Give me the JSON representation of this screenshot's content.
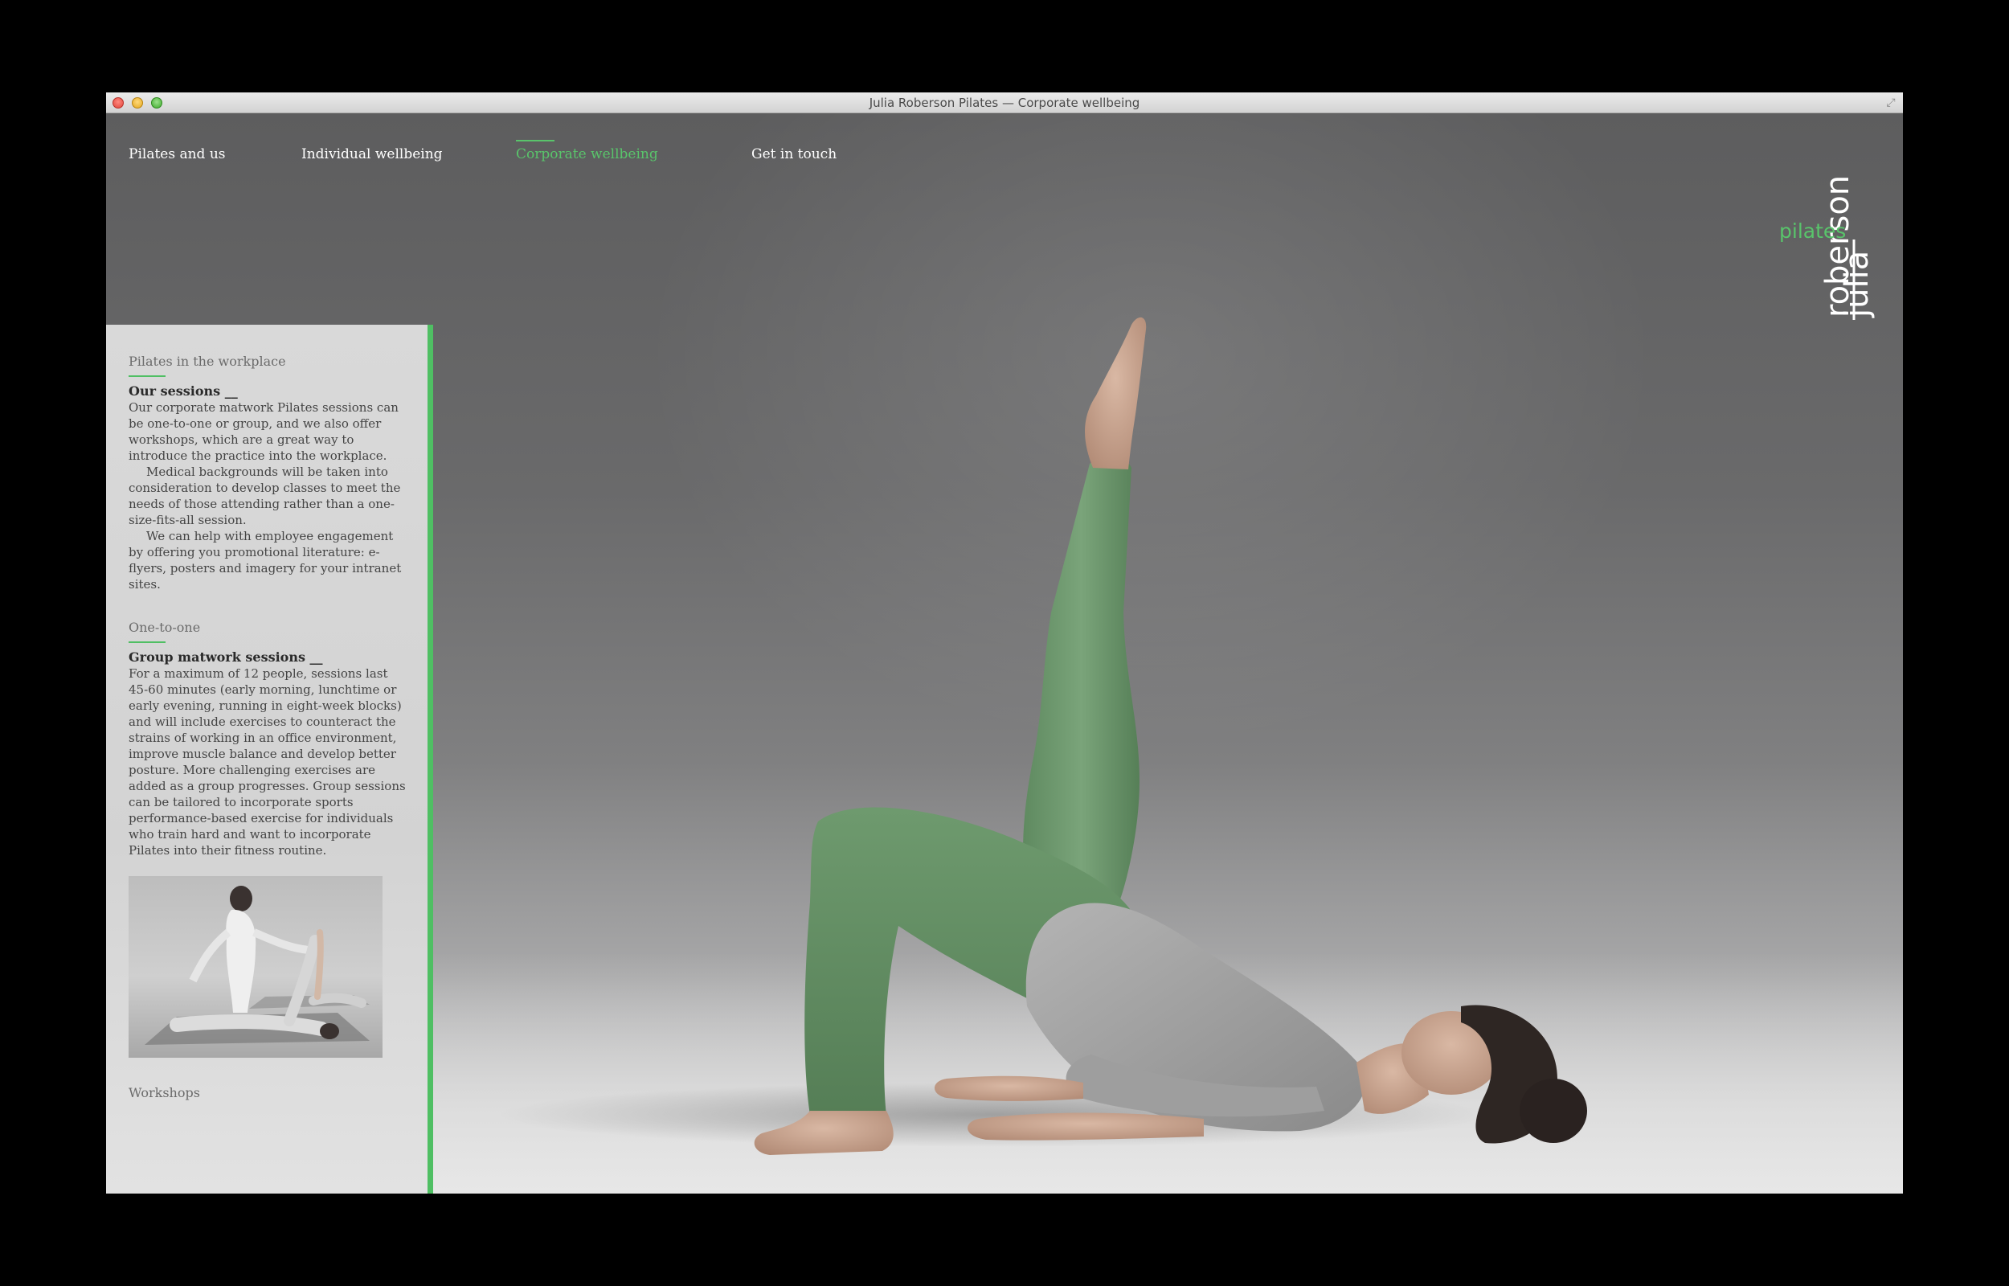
{
  "window": {
    "title": "Julia Roberson Pilates — Corporate wellbeing"
  },
  "nav": {
    "items": [
      {
        "label": "Pilates and us",
        "active": false
      },
      {
        "label": "Individual wellbeing",
        "active": false
      },
      {
        "label": "Corporate wellbeing",
        "active": true
      },
      {
        "label": "Get in touch",
        "active": false
      }
    ]
  },
  "logo": {
    "first": "julia",
    "last": "roberson",
    "tag": "pilates"
  },
  "sidebar": {
    "sections": [
      {
        "heading": "Pilates in the workplace",
        "subheading": "Our sessions __",
        "paragraphs": [
          "Our corporate matwork Pilates sessions can be one-to-one or group, and we also offer workshops, which are a great way to introduce the practice into the workplace.",
          "Medical backgrounds will be taken into consideration to develop classes to meet the needs of those attending rather than a one-size-fits-all session.",
          "We can help with employee engagement by offering you promotional literature: e-flyers, posters and imagery for your intranet sites."
        ]
      },
      {
        "heading": "One-to-one",
        "subheading": "Group matwork sessions __",
        "paragraphs": [
          "For a maximum of 12 people, sessions last 45-60 minutes (early morning, lunchtime or early evening, running in eight-week blocks) and will include exercises to counteract the strains of working in an office environment, improve muscle balance and develop better posture. More challenging exercises are added as a group progresses. Group sessions can be tailored to incorporate sports performance-based exercise for individuals who train hard and want to incorporate Pilates into their fitness routine."
        ]
      },
      {
        "heading": "Workshops"
      }
    ]
  },
  "colors": {
    "accent": "#4fbf63",
    "nav_active": "#59c46b",
    "sidebar_bg": "#d6d6d6",
    "legging_green": "#6f9a6f",
    "top_grey": "#9a9a9a"
  }
}
